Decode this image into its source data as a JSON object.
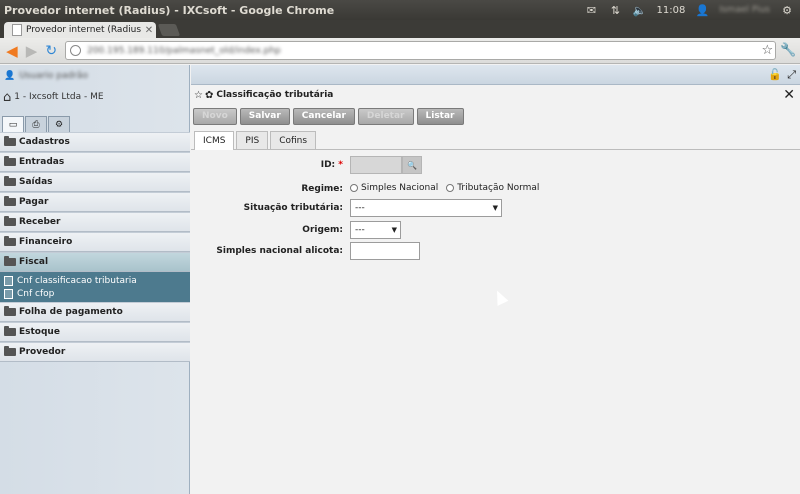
{
  "os": {
    "window_title": "Provedor internet (Radius) - IXCsoft - Google Chrome",
    "time": "11:08",
    "user": "Ismael Pius",
    "icons": [
      "mail-icon",
      "network-icon",
      "volume-icon",
      "user-icon",
      "settings-icon"
    ]
  },
  "browser": {
    "tab_title": "Provedor internet (Radius",
    "url": "200.195.189.110/palmasnet_old/index.php"
  },
  "sidebar": {
    "user_name": "Usuario padrão",
    "company": "1 - Ixcsoft Ltda - ME",
    "menu": [
      {
        "label": "Cadastros"
      },
      {
        "label": "Entradas"
      },
      {
        "label": "Saídas"
      },
      {
        "label": "Pagar"
      },
      {
        "label": "Receber"
      },
      {
        "label": "Financeiro"
      },
      {
        "label": "Fiscal"
      },
      {
        "label": "Folha de pagamento"
      },
      {
        "label": "Estoque"
      },
      {
        "label": "Provedor"
      }
    ],
    "fiscal_sub": [
      "Cnf classificacao tributaria",
      "Cnf cfop"
    ]
  },
  "page": {
    "title": "Classificação tributária",
    "buttons": {
      "novo": "Novo",
      "salvar": "Salvar",
      "cancelar": "Cancelar",
      "deletar": "Deletar",
      "listar": "Listar"
    },
    "tabs": [
      "ICMS",
      "PIS",
      "Cofins"
    ]
  },
  "form": {
    "id_label": "ID:",
    "required_mark": "*",
    "regime_label": "Regime:",
    "regime_options": [
      "Simples Nacional",
      "Tributação Normal"
    ],
    "situacao_label": "Situação tributária:",
    "situacao_value": "---",
    "origem_label": "Origem:",
    "origem_value": "---",
    "aliquota_label": "Simples nacional alicota:"
  }
}
